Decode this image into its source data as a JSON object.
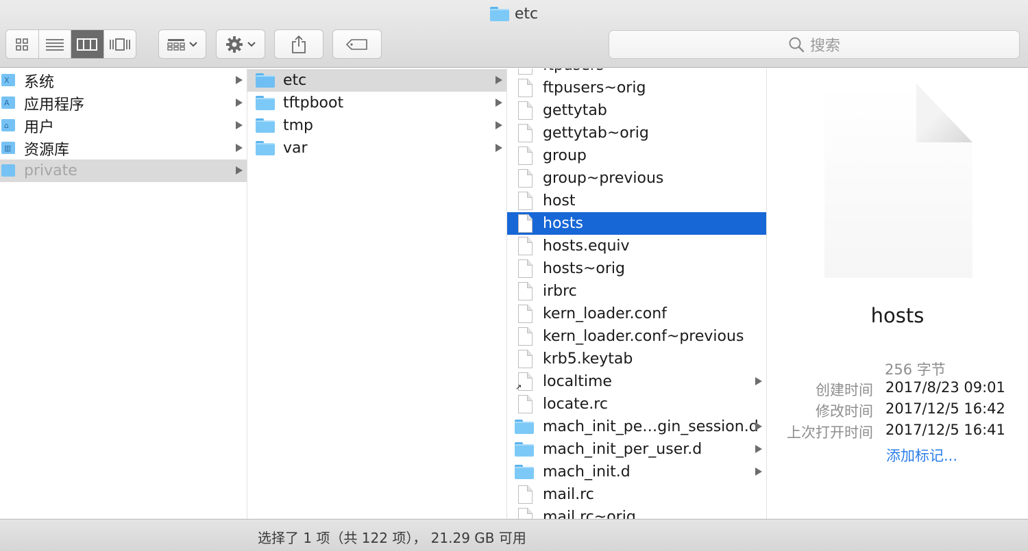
{
  "window": {
    "title": "etc",
    "title_icon": "folder-icon"
  },
  "toolbar": {
    "view_modes": [
      {
        "name": "icon-view-icon",
        "active": false
      },
      {
        "name": "list-view-icon",
        "active": false
      },
      {
        "name": "column-view-icon",
        "active": true
      },
      {
        "name": "cover-flow-icon",
        "active": false
      }
    ],
    "arrange_icon": "arrange-grid-icon",
    "action_icon": "gear-icon",
    "share_icon": "share-icon",
    "tag_icon": "tag-icon",
    "search_placeholder": "搜索"
  },
  "sidebar_column": [
    {
      "label": "系统",
      "glyph": "X",
      "has_arrow": true,
      "state": "normal"
    },
    {
      "label": "应用程序",
      "glyph": "A",
      "has_arrow": true,
      "state": "normal"
    },
    {
      "label": "用户",
      "glyph": "⌂",
      "has_arrow": true,
      "state": "normal"
    },
    {
      "label": "资源库",
      "glyph": "▥",
      "has_arrow": true,
      "state": "normal"
    },
    {
      "label": "private",
      "glyph": "",
      "has_arrow": true,
      "state": "selected-dim"
    }
  ],
  "folder_column": [
    {
      "label": "etc",
      "has_arrow": true,
      "selected": true
    },
    {
      "label": "tftpboot",
      "has_arrow": true,
      "selected": false
    },
    {
      "label": "tmp",
      "has_arrow": true,
      "selected": false
    },
    {
      "label": "var",
      "has_arrow": true,
      "selected": false
    }
  ],
  "file_column": [
    {
      "label": "ftpusers",
      "kind": "file"
    },
    {
      "label": "ftpusers~orig",
      "kind": "file"
    },
    {
      "label": "gettytab",
      "kind": "file"
    },
    {
      "label": "gettytab~orig",
      "kind": "file"
    },
    {
      "label": "group",
      "kind": "file"
    },
    {
      "label": "group~previous",
      "kind": "file"
    },
    {
      "label": "host",
      "kind": "file"
    },
    {
      "label": "hosts",
      "kind": "file",
      "selected": true
    },
    {
      "label": "hosts.equiv",
      "kind": "file"
    },
    {
      "label": "hosts~orig",
      "kind": "file"
    },
    {
      "label": "irbrc",
      "kind": "file"
    },
    {
      "label": "kern_loader.conf",
      "kind": "file"
    },
    {
      "label": "kern_loader.conf~previous",
      "kind": "file"
    },
    {
      "label": "krb5.keytab",
      "kind": "file"
    },
    {
      "label": "localtime",
      "kind": "alias",
      "has_arrow": true
    },
    {
      "label": "locate.rc",
      "kind": "file"
    },
    {
      "label": "mach_init_pe…gin_session.d",
      "kind": "folder",
      "has_arrow": true
    },
    {
      "label": "mach_init_per_user.d",
      "kind": "folder",
      "has_arrow": true
    },
    {
      "label": "mach_init.d",
      "kind": "folder",
      "has_arrow": true
    },
    {
      "label": "mail.rc",
      "kind": "file"
    },
    {
      "label": "mail.rc~orig",
      "kind": "file"
    }
  ],
  "preview": {
    "name": "hosts",
    "size": "256 字节",
    "meta": [
      {
        "key": "创建时间",
        "value": "2017/8/23 09:01"
      },
      {
        "key": "修改时间",
        "value": "2017/12/5 16:42"
      },
      {
        "key": "上次打开时间",
        "value": "2017/12/5 16:41"
      }
    ],
    "add_tags": "添加标记..."
  },
  "status_bar": {
    "text": "选择了 1 项（共 122 项）， 21.29 GB 可用"
  },
  "colors": {
    "selection_blue": "#1767d6",
    "selection_gray": "#dadada",
    "folder_blue": "#7cc9f7",
    "link_blue": "#2b7de9"
  }
}
